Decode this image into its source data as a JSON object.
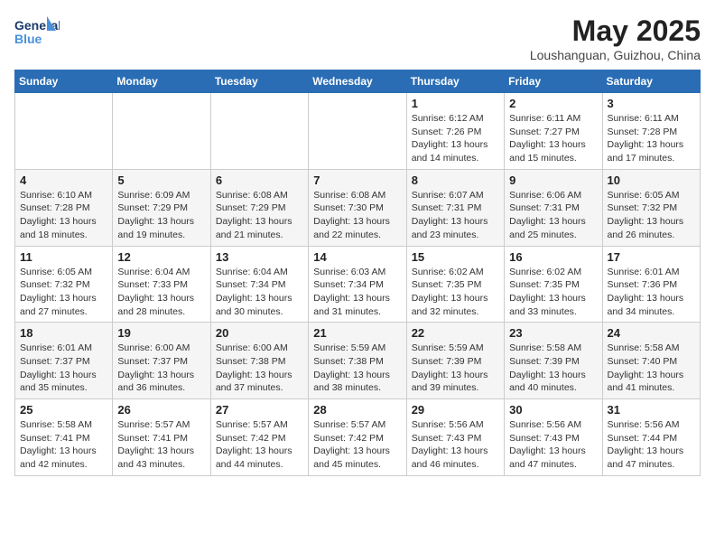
{
  "header": {
    "logo_line1": "General",
    "logo_line2": "Blue",
    "month_year": "May 2025",
    "location": "Loushanguan, Guizhou, China"
  },
  "days_of_week": [
    "Sunday",
    "Monday",
    "Tuesday",
    "Wednesday",
    "Thursday",
    "Friday",
    "Saturday"
  ],
  "weeks": [
    [
      {
        "day": "",
        "info": ""
      },
      {
        "day": "",
        "info": ""
      },
      {
        "day": "",
        "info": ""
      },
      {
        "day": "",
        "info": ""
      },
      {
        "day": "1",
        "info": "Sunrise: 6:12 AM\nSunset: 7:26 PM\nDaylight: 13 hours\nand 14 minutes."
      },
      {
        "day": "2",
        "info": "Sunrise: 6:11 AM\nSunset: 7:27 PM\nDaylight: 13 hours\nand 15 minutes."
      },
      {
        "day": "3",
        "info": "Sunrise: 6:11 AM\nSunset: 7:28 PM\nDaylight: 13 hours\nand 17 minutes."
      }
    ],
    [
      {
        "day": "4",
        "info": "Sunrise: 6:10 AM\nSunset: 7:28 PM\nDaylight: 13 hours\nand 18 minutes."
      },
      {
        "day": "5",
        "info": "Sunrise: 6:09 AM\nSunset: 7:29 PM\nDaylight: 13 hours\nand 19 minutes."
      },
      {
        "day": "6",
        "info": "Sunrise: 6:08 AM\nSunset: 7:29 PM\nDaylight: 13 hours\nand 21 minutes."
      },
      {
        "day": "7",
        "info": "Sunrise: 6:08 AM\nSunset: 7:30 PM\nDaylight: 13 hours\nand 22 minutes."
      },
      {
        "day": "8",
        "info": "Sunrise: 6:07 AM\nSunset: 7:31 PM\nDaylight: 13 hours\nand 23 minutes."
      },
      {
        "day": "9",
        "info": "Sunrise: 6:06 AM\nSunset: 7:31 PM\nDaylight: 13 hours\nand 25 minutes."
      },
      {
        "day": "10",
        "info": "Sunrise: 6:05 AM\nSunset: 7:32 PM\nDaylight: 13 hours\nand 26 minutes."
      }
    ],
    [
      {
        "day": "11",
        "info": "Sunrise: 6:05 AM\nSunset: 7:32 PM\nDaylight: 13 hours\nand 27 minutes."
      },
      {
        "day": "12",
        "info": "Sunrise: 6:04 AM\nSunset: 7:33 PM\nDaylight: 13 hours\nand 28 minutes."
      },
      {
        "day": "13",
        "info": "Sunrise: 6:04 AM\nSunset: 7:34 PM\nDaylight: 13 hours\nand 30 minutes."
      },
      {
        "day": "14",
        "info": "Sunrise: 6:03 AM\nSunset: 7:34 PM\nDaylight: 13 hours\nand 31 minutes."
      },
      {
        "day": "15",
        "info": "Sunrise: 6:02 AM\nSunset: 7:35 PM\nDaylight: 13 hours\nand 32 minutes."
      },
      {
        "day": "16",
        "info": "Sunrise: 6:02 AM\nSunset: 7:35 PM\nDaylight: 13 hours\nand 33 minutes."
      },
      {
        "day": "17",
        "info": "Sunrise: 6:01 AM\nSunset: 7:36 PM\nDaylight: 13 hours\nand 34 minutes."
      }
    ],
    [
      {
        "day": "18",
        "info": "Sunrise: 6:01 AM\nSunset: 7:37 PM\nDaylight: 13 hours\nand 35 minutes."
      },
      {
        "day": "19",
        "info": "Sunrise: 6:00 AM\nSunset: 7:37 PM\nDaylight: 13 hours\nand 36 minutes."
      },
      {
        "day": "20",
        "info": "Sunrise: 6:00 AM\nSunset: 7:38 PM\nDaylight: 13 hours\nand 37 minutes."
      },
      {
        "day": "21",
        "info": "Sunrise: 5:59 AM\nSunset: 7:38 PM\nDaylight: 13 hours\nand 38 minutes."
      },
      {
        "day": "22",
        "info": "Sunrise: 5:59 AM\nSunset: 7:39 PM\nDaylight: 13 hours\nand 39 minutes."
      },
      {
        "day": "23",
        "info": "Sunrise: 5:58 AM\nSunset: 7:39 PM\nDaylight: 13 hours\nand 40 minutes."
      },
      {
        "day": "24",
        "info": "Sunrise: 5:58 AM\nSunset: 7:40 PM\nDaylight: 13 hours\nand 41 minutes."
      }
    ],
    [
      {
        "day": "25",
        "info": "Sunrise: 5:58 AM\nSunset: 7:41 PM\nDaylight: 13 hours\nand 42 minutes."
      },
      {
        "day": "26",
        "info": "Sunrise: 5:57 AM\nSunset: 7:41 PM\nDaylight: 13 hours\nand 43 minutes."
      },
      {
        "day": "27",
        "info": "Sunrise: 5:57 AM\nSunset: 7:42 PM\nDaylight: 13 hours\nand 44 minutes."
      },
      {
        "day": "28",
        "info": "Sunrise: 5:57 AM\nSunset: 7:42 PM\nDaylight: 13 hours\nand 45 minutes."
      },
      {
        "day": "29",
        "info": "Sunrise: 5:56 AM\nSunset: 7:43 PM\nDaylight: 13 hours\nand 46 minutes."
      },
      {
        "day": "30",
        "info": "Sunrise: 5:56 AM\nSunset: 7:43 PM\nDaylight: 13 hours\nand 47 minutes."
      },
      {
        "day": "31",
        "info": "Sunrise: 5:56 AM\nSunset: 7:44 PM\nDaylight: 13 hours\nand 47 minutes."
      }
    ]
  ]
}
